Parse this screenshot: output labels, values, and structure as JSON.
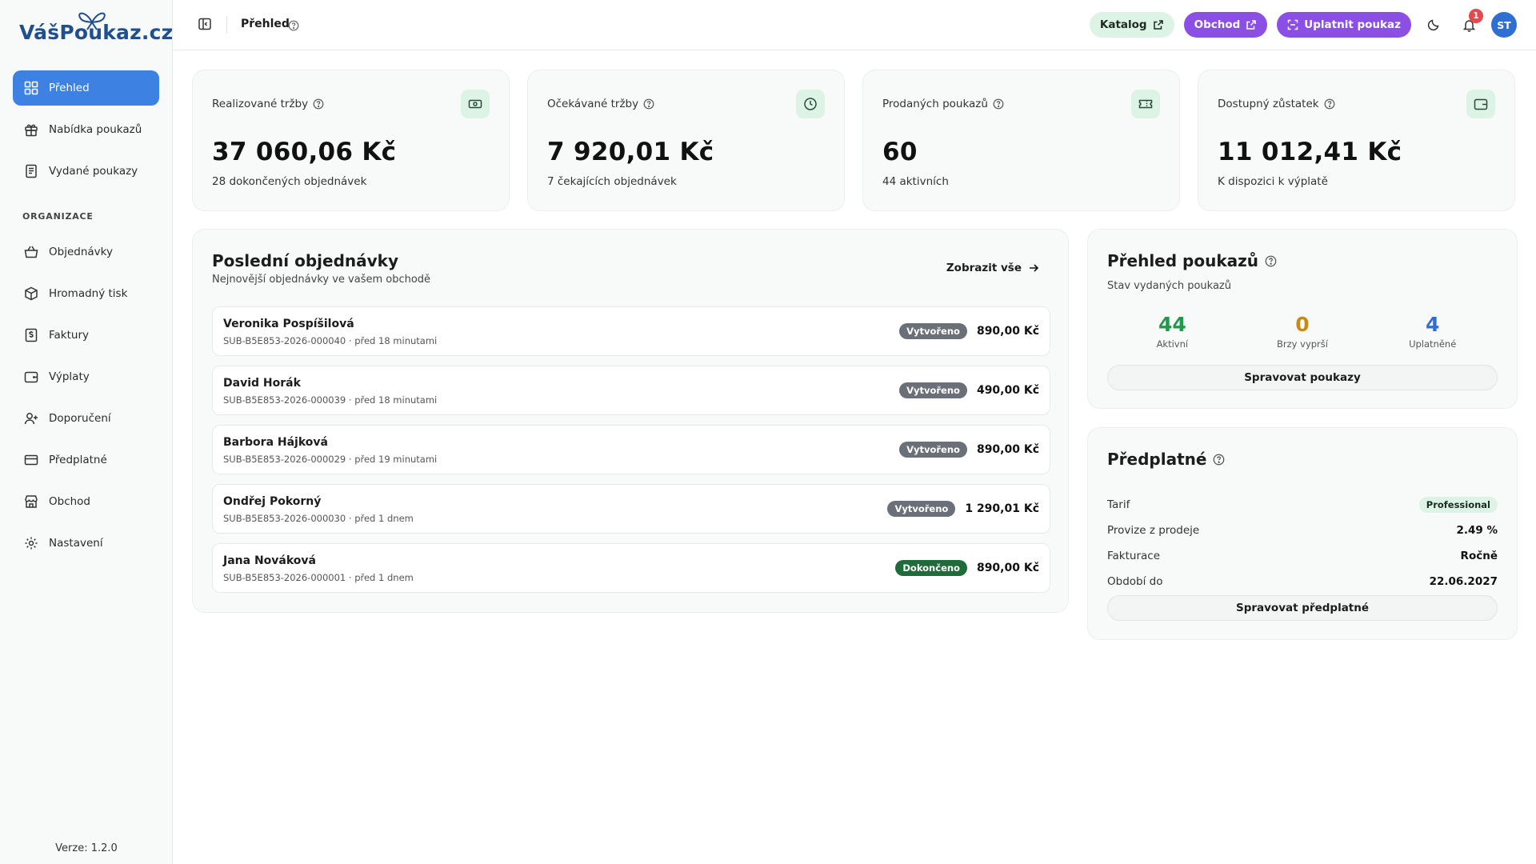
{
  "brand": {
    "logo_text": "VášPoukaz.cz",
    "accent": "#3d82e3",
    "purple": "#8b4fe6",
    "mint": "#dcf3e6"
  },
  "sidebar": {
    "items": [
      {
        "label": "Přehled",
        "icon": "dashboard-icon",
        "active": true
      },
      {
        "label": "Nabídka poukazů",
        "icon": "gift-icon"
      },
      {
        "label": "Vydané poukazy",
        "icon": "receipt-icon"
      }
    ],
    "section_label": "ORGANIZACE",
    "org_items": [
      {
        "label": "Objednávky",
        "icon": "basket-icon"
      },
      {
        "label": "Hromadný tisk",
        "icon": "package-icon"
      },
      {
        "label": "Faktury",
        "icon": "invoice-icon"
      },
      {
        "label": "Výplaty",
        "icon": "wallet-icon"
      },
      {
        "label": "Doporučení",
        "icon": "user-plus-icon"
      },
      {
        "label": "Předplatné",
        "icon": "credit-card-icon"
      },
      {
        "label": "Obchod",
        "icon": "store-icon"
      },
      {
        "label": "Nastavení",
        "icon": "gear-icon"
      }
    ],
    "version": "Verze: 1.2.0"
  },
  "topbar": {
    "title": "Přehled",
    "katalog": "Katalog",
    "obchod": "Obchod",
    "uplatnit": "Uplatnit poukaz",
    "notification_count": "1",
    "avatar_initials": "ST"
  },
  "stats": [
    {
      "label": "Realizované tržby",
      "value": "37 060,06 Kč",
      "sub": "28 dokončených objednávek",
      "icon": "cash-icon"
    },
    {
      "label": "Očekávané tržby",
      "value": "7 920,01 Kč",
      "sub": "7 čekajících objednávek",
      "icon": "clock-icon"
    },
    {
      "label": "Prodaných poukazů",
      "value": "60",
      "sub": "44 aktivních",
      "icon": "ticket-icon"
    },
    {
      "label": "Dostupný zůstatek",
      "value": "11 012,41 Kč",
      "sub": "K dispozici k výplatě",
      "icon": "wallet-icon"
    }
  ],
  "orders": {
    "title": "Poslední objednávky",
    "subtitle": "Nejnovější objednávky ve vašem obchodě",
    "show_all": "Zobrazit vše",
    "rows": [
      {
        "name": "Veronika Pospíšilová",
        "meta": "SUB-B5E853-2026-000040 · před 18 minutami",
        "status": "Vytvořeno",
        "amount": "890,00 Kč"
      },
      {
        "name": "David Horák",
        "meta": "SUB-B5E853-2026-000039 · před 18 minutami",
        "status": "Vytvořeno",
        "amount": "490,00 Kč"
      },
      {
        "name": "Barbora Hájková",
        "meta": "SUB-B5E853-2026-000029 · před 19 minutami",
        "status": "Vytvořeno",
        "amount": "890,00 Kč"
      },
      {
        "name": "Ondřej Pokorný",
        "meta": "SUB-B5E853-2026-000030 · před 1 dnem",
        "status": "Vytvořeno",
        "amount": "1 290,01 Kč"
      },
      {
        "name": "Jana Nováková",
        "meta": "SUB-B5E853-2026-000001 · před 1 dnem",
        "status": "Dokončeno",
        "amount": "890,00 Kč"
      }
    ]
  },
  "vouchers": {
    "title": "Přehled poukazů",
    "subtitle": "Stav vydaných poukazů",
    "stats": [
      {
        "value": "44",
        "label": "Aktivní",
        "color": "#1f9a4a"
      },
      {
        "value": "0",
        "label": "Brzy vyprší",
        "color": "#c98a12"
      },
      {
        "value": "4",
        "label": "Uplatněné",
        "color": "#2f6fd4"
      }
    ],
    "button": "Spravovat poukazy"
  },
  "subscription": {
    "title": "Předplatné",
    "rows": [
      {
        "key": "Tarif",
        "value": "Professional"
      },
      {
        "key": "Provize z prodeje",
        "value": "2.49 %"
      },
      {
        "key": "Fakturace",
        "value": "Ročně"
      },
      {
        "key": "Období do",
        "value": "22.06.2027"
      }
    ],
    "button": "Spravovat předplatné"
  }
}
